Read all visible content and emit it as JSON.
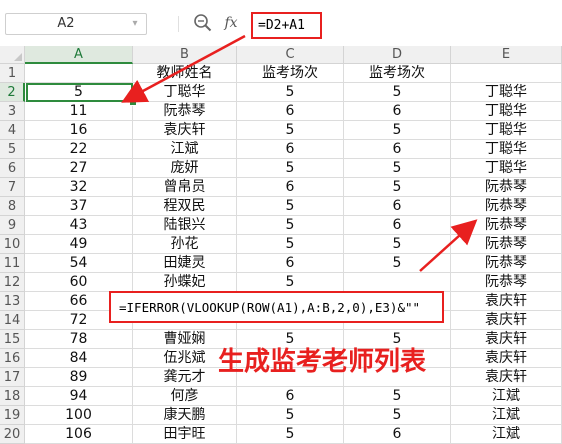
{
  "formula_bar": {
    "name_box": "A2",
    "fx_label": "fx",
    "formula": "=D2+A1"
  },
  "columns": [
    "A",
    "B",
    "C",
    "D",
    "E"
  ],
  "rows": [
    {
      "num": "1",
      "cells": [
        "",
        "教师姓名",
        "监考场次",
        "监考场次",
        ""
      ]
    },
    {
      "num": "2",
      "cells": [
        "5",
        "丁聪华",
        "5",
        "5",
        "丁聪华"
      ]
    },
    {
      "num": "3",
      "cells": [
        "11",
        "阮恭琴",
        "6",
        "6",
        "丁聪华"
      ]
    },
    {
      "num": "4",
      "cells": [
        "16",
        "袁庆轩",
        "5",
        "5",
        "丁聪华"
      ]
    },
    {
      "num": "5",
      "cells": [
        "22",
        "江斌",
        "6",
        "6",
        "丁聪华"
      ]
    },
    {
      "num": "6",
      "cells": [
        "27",
        "庞妍",
        "5",
        "5",
        "丁聪华"
      ]
    },
    {
      "num": "7",
      "cells": [
        "32",
        "曾帛员",
        "6",
        "5",
        "阮恭琴"
      ]
    },
    {
      "num": "8",
      "cells": [
        "37",
        "程双民",
        "5",
        "6",
        "阮恭琴"
      ]
    },
    {
      "num": "9",
      "cells": [
        "43",
        "陆银兴",
        "5",
        "6",
        "阮恭琴"
      ]
    },
    {
      "num": "10",
      "cells": [
        "49",
        "孙花",
        "5",
        "5",
        "阮恭琴"
      ]
    },
    {
      "num": "11",
      "cells": [
        "54",
        "田婕灵",
        "6",
        "5",
        "阮恭琴"
      ]
    },
    {
      "num": "12",
      "cells": [
        "60",
        "孙蝶妃",
        "5",
        "",
        "阮恭琴"
      ]
    },
    {
      "num": "13",
      "cells": [
        "66",
        "",
        "",
        "",
        "袁庆轩"
      ]
    },
    {
      "num": "14",
      "cells": [
        "72",
        "",
        "",
        "",
        "袁庆轩"
      ]
    },
    {
      "num": "15",
      "cells": [
        "78",
        "曹娅娴",
        "5",
        "5",
        "袁庆轩"
      ]
    },
    {
      "num": "16",
      "cells": [
        "84",
        "伍兆斌",
        "",
        "",
        "袁庆轩"
      ]
    },
    {
      "num": "17",
      "cells": [
        "89",
        "龚元才",
        "",
        "",
        "袁庆轩"
      ]
    },
    {
      "num": "18",
      "cells": [
        "94",
        "何彦",
        "6",
        "5",
        "江斌"
      ]
    },
    {
      "num": "19",
      "cells": [
        "100",
        "康天鹏",
        "5",
        "5",
        "江斌"
      ]
    },
    {
      "num": "20",
      "cells": [
        "106",
        "田宇旺",
        "5",
        "6",
        "江斌"
      ]
    }
  ],
  "annotations": {
    "formula_callout": "=IFERROR(VLOOKUP(ROW(A1),A:B,2,0),E3)&\"\"",
    "headline": "生成监考老师列表"
  },
  "colors": {
    "accent_red": "#e8201f",
    "selection_green": "#2e8b3d"
  },
  "icons": [
    "dropdown-icon",
    "zoom-icon",
    "function-icon"
  ]
}
